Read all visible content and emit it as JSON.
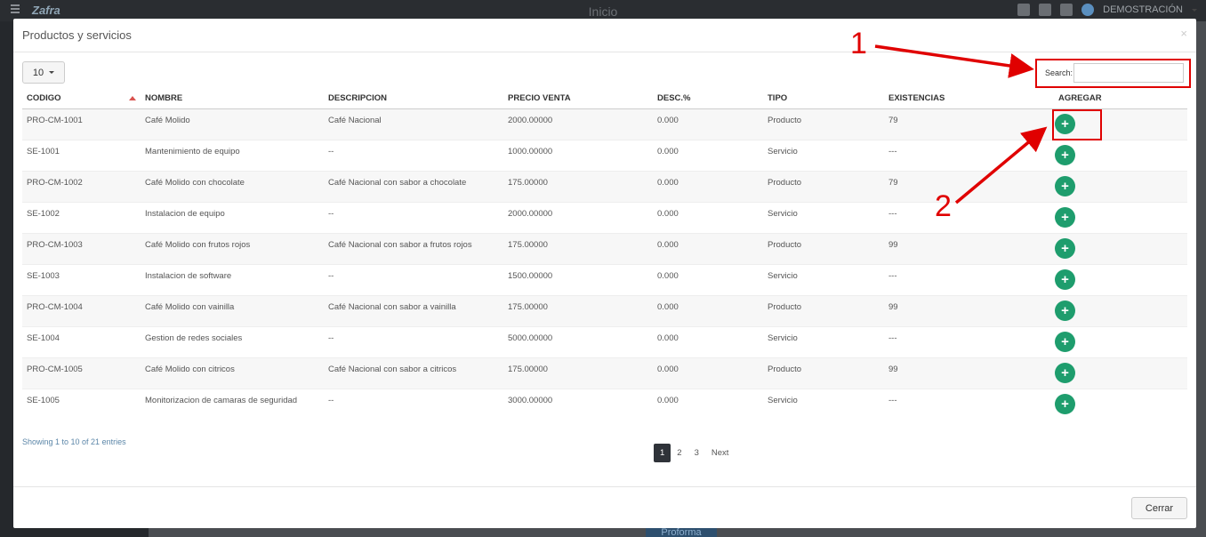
{
  "app": {
    "logo": "Zafra",
    "page_title": "Inicio",
    "user_name": "DEMOSTRACIÓN",
    "background_button": "Proforma"
  },
  "modal": {
    "title": "Productos y servicios",
    "close_symbol": "×",
    "length_value": "10",
    "search_label": "Search:",
    "search_value": "",
    "info_text": "Showing 1 to 10 of 21 entries",
    "close_button": "Cerrar"
  },
  "table": {
    "headers": [
      "CODIGO",
      "NOMBRE",
      "DESCRIPCION",
      "PRECIO VENTA",
      "DESC.%",
      "TIPO",
      "EXISTENCIAS",
      "AGREGAR"
    ],
    "rows": [
      {
        "codigo": "PRO-CM-1001",
        "nombre": "Café Molido",
        "descripcion": "Café Nacional",
        "precio": "2000.00000",
        "desc": "0.000",
        "tipo": "Producto",
        "existencias": "79"
      },
      {
        "codigo": "SE-1001",
        "nombre": "Mantenimiento de equipo",
        "descripcion": "--",
        "precio": "1000.00000",
        "desc": "0.000",
        "tipo": "Servicio",
        "existencias": "---"
      },
      {
        "codigo": "PRO-CM-1002",
        "nombre": "Café Molido con chocolate",
        "descripcion": "Café Nacional con sabor a chocolate",
        "precio": "175.00000",
        "desc": "0.000",
        "tipo": "Producto",
        "existencias": "79"
      },
      {
        "codigo": "SE-1002",
        "nombre": "Instalacion de equipo",
        "descripcion": "--",
        "precio": "2000.00000",
        "desc": "0.000",
        "tipo": "Servicio",
        "existencias": "---"
      },
      {
        "codigo": "PRO-CM-1003",
        "nombre": "Café Molido con frutos rojos",
        "descripcion": "Café Nacional con sabor a frutos rojos",
        "precio": "175.00000",
        "desc": "0.000",
        "tipo": "Producto",
        "existencias": "99"
      },
      {
        "codigo": "SE-1003",
        "nombre": "Instalacion de software",
        "descripcion": "--",
        "precio": "1500.00000",
        "desc": "0.000",
        "tipo": "Servicio",
        "existencias": "---"
      },
      {
        "codigo": "PRO-CM-1004",
        "nombre": "Café Molido con vainilla",
        "descripcion": "Café Nacional con sabor a vainilla",
        "precio": "175.00000",
        "desc": "0.000",
        "tipo": "Producto",
        "existencias": "99"
      },
      {
        "codigo": "SE-1004",
        "nombre": "Gestion de redes sociales",
        "descripcion": "--",
        "precio": "5000.00000",
        "desc": "0.000",
        "tipo": "Servicio",
        "existencias": "---"
      },
      {
        "codigo": "PRO-CM-1005",
        "nombre": "Café Molido con citricos",
        "descripcion": "Café Nacional con sabor a citricos",
        "precio": "175.00000",
        "desc": "0.000",
        "tipo": "Producto",
        "existencias": "99"
      },
      {
        "codigo": "SE-1005",
        "nombre": "Monitorizacion de camaras de seguridad",
        "descripcion": "--",
        "precio": "3000.00000",
        "desc": "0.000",
        "tipo": "Servicio",
        "existencias": "---"
      }
    ],
    "add_symbol": "+"
  },
  "pagination": {
    "pages": [
      "1",
      "2",
      "3"
    ],
    "next": "Next"
  },
  "annotations": {
    "label_1": "1",
    "label_2": "2",
    "color": "#e00000"
  }
}
